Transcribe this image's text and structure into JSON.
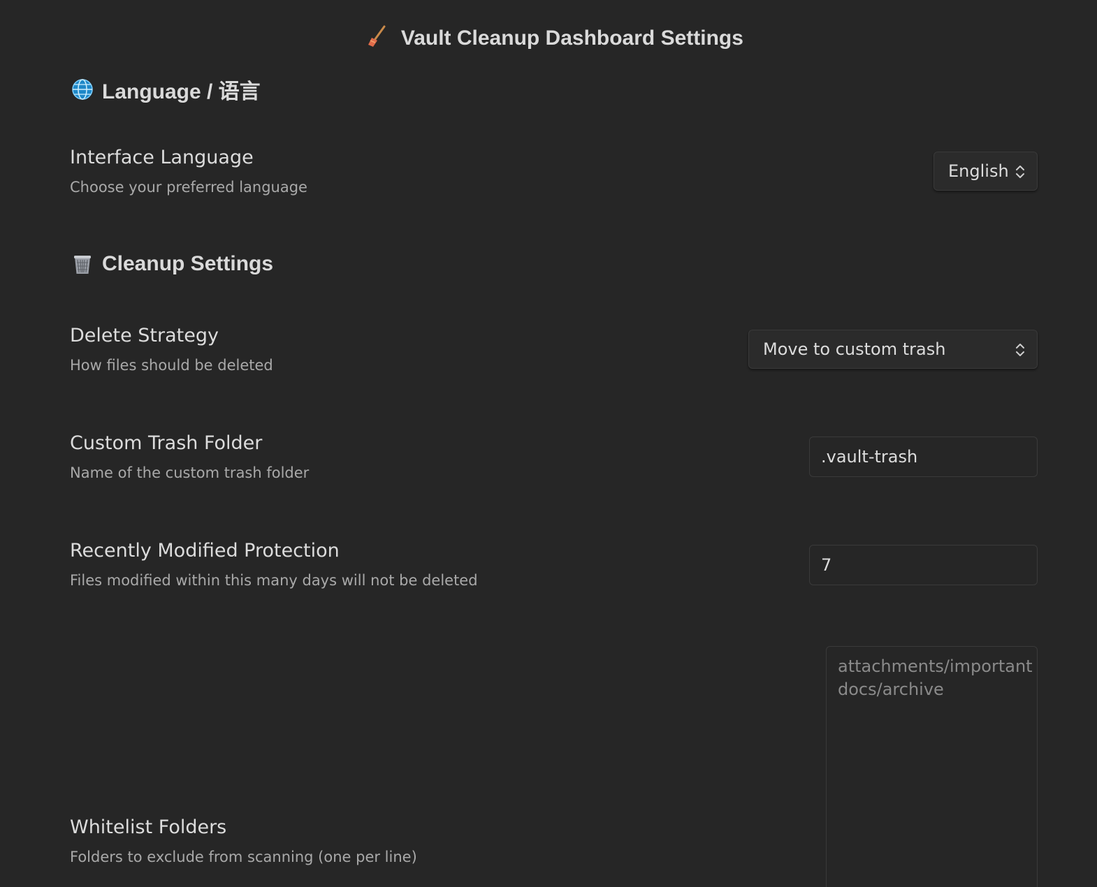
{
  "page": {
    "title": "Vault Cleanup Dashboard Settings",
    "title_icon": "broom-icon"
  },
  "sections": {
    "language": {
      "heading": "Language / 语言",
      "icon": "globe-icon"
    },
    "cleanup": {
      "heading": "Cleanup Settings",
      "icon": "wastebasket-icon"
    }
  },
  "settings": {
    "interface_language": {
      "name": "Interface Language",
      "desc": "Choose your preferred language",
      "value": "English"
    },
    "delete_strategy": {
      "name": "Delete Strategy",
      "desc": "How files should be deleted",
      "value": "Move to custom trash"
    },
    "custom_trash_folder": {
      "name": "Custom Trash Folder",
      "desc": "Name of the custom trash folder",
      "value": ".vault-trash"
    },
    "recently_modified": {
      "name": "Recently Modified Protection",
      "desc": "Files modified within this many days will not be deleted",
      "value": "7"
    },
    "whitelist_folders": {
      "name": "Whitelist Folders",
      "desc": "Folders to exclude from scanning (one per line)",
      "placeholder_lines": [
        "attachments/important",
        "docs/archive"
      ]
    }
  },
  "colors": {
    "background": "#262626",
    "text": "#dcdcdc",
    "muted_text": "#a9a9a9",
    "border": "#3a3a3a"
  }
}
